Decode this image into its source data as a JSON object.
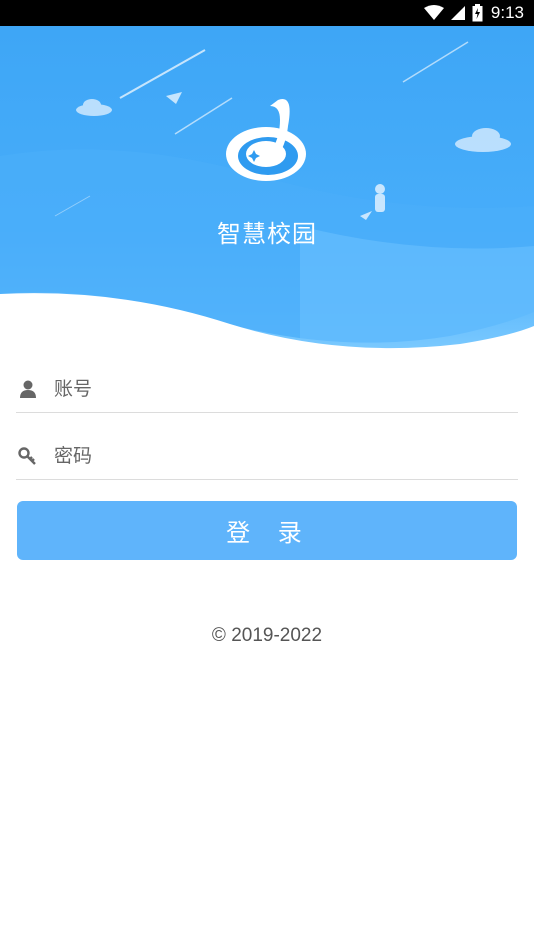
{
  "status_bar": {
    "time": "9:13",
    "icons": [
      "wifi-icon",
      "signal-icon",
      "battery-icon"
    ]
  },
  "header": {
    "app_title": "智慧校园",
    "logo": "campus-logo",
    "colors": {
      "sky_top": "#2f9bf0",
      "sky_bottom": "#7cc6ff",
      "wave": "#64bdfd"
    }
  },
  "login_form": {
    "account_placeholder": "账号",
    "password_placeholder": "密码",
    "account_icon": "user-icon",
    "password_icon": "key-icon",
    "submit_label": "登 录",
    "button_color": "#5fb4fb"
  },
  "footer": {
    "copyright": "© 2019-2022"
  }
}
